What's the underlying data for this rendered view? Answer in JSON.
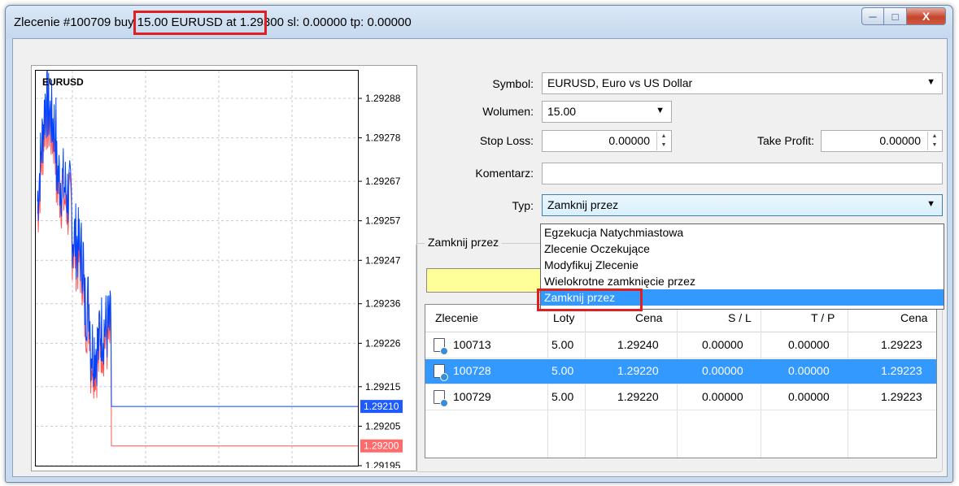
{
  "window": {
    "title_prefix": "Zlecenie #100709 ",
    "title_highlight": "buy 15.00 EURUSD",
    "title_suffix": " at 1.29300 sl: 0.00000 tp: 0.00000",
    "min_icon": "minimize-icon",
    "max_icon": "maximize-icon",
    "close_icon": "close-icon"
  },
  "chart_data": {
    "type": "line",
    "symbol": "EURUSD",
    "ylabels": [
      "1.29288",
      "1.29278",
      "1.29267",
      "1.29257",
      "1.29247",
      "1.29236",
      "1.29226",
      "1.29215",
      "1.29205",
      "1.29195"
    ],
    "ylim": [
      1.29195,
      1.29295
    ],
    "series": [
      {
        "name": "bid",
        "color": "#0044ff"
      },
      {
        "name": "ask",
        "color": "#ff5555"
      }
    ],
    "bid_price": "1.29210",
    "ask_price": "1.29200",
    "bid_color": "#1e5bff",
    "ask_color": "#ff6b6b"
  },
  "form": {
    "symbol_label": "Symbol:",
    "symbol_value": "EURUSD, Euro vs US Dollar",
    "volume_label": "Wolumen:",
    "volume_value": "15.00",
    "sl_label": "Stop Loss:",
    "sl_value": "0.00000",
    "tp_label": "Take Profit:",
    "tp_value": "0.00000",
    "comment_label": "Komentarz:",
    "comment_value": "",
    "type_label": "Typ:",
    "type_value": "Zamknij przez"
  },
  "dropdown": {
    "items": [
      "Egzekucja Natychmiastowa",
      "Zlecenie Oczekujące",
      "Modyfikuj Zlecenie",
      "Wielokrotne zamknięcie przez",
      "Zamknij przez"
    ],
    "selected_index": 4
  },
  "group": {
    "title": "Zamknij przez"
  },
  "table": {
    "headers": [
      "Zlecenie",
      "Loty",
      "Cena",
      "S / L",
      "T / P",
      "Cena"
    ],
    "rows": [
      {
        "order": "100713",
        "lots": "5.00",
        "price": "1.29240",
        "sl": "0.00000",
        "tp": "0.00000",
        "cur": "1.29223",
        "selected": false
      },
      {
        "order": "100728",
        "lots": "5.00",
        "price": "1.29220",
        "sl": "0.00000",
        "tp": "0.00000",
        "cur": "1.29223",
        "selected": true
      },
      {
        "order": "100729",
        "lots": "5.00",
        "price": "1.29220",
        "sl": "0.00000",
        "tp": "0.00000",
        "cur": "1.29223",
        "selected": false
      }
    ]
  },
  "colors": {
    "highlight": "#e02020",
    "selection": "#3399ff",
    "yellow": "#ffff99"
  }
}
